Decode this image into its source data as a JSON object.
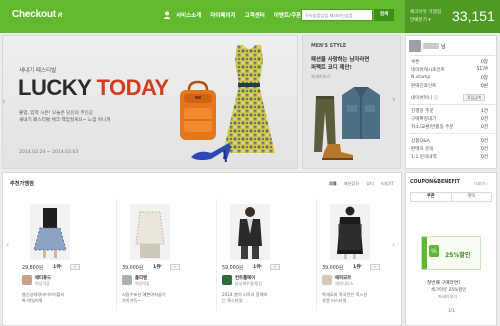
{
  "header": {
    "logo": "Checkout",
    "logo_mark": "R",
    "nav": [
      "서비스소개",
      "마이페이지",
      "고객센터",
      "이벤트/쿠폰"
    ],
    "search_placeholder": "직속상품입점 페셔라인상품",
    "search_button": "검색",
    "counter_label1": "체크아웃 가맹점",
    "counter_label2": "만배분기 ▾",
    "counter_value": "33,151",
    "accent": "#62b92e"
  },
  "hero": {
    "subtitle": "새내기 페스티벌",
    "title_a": "LUCKY",
    "title_b": "TODAY",
    "desc1": "졸업, 입학 시즌! 오늘은 당신의 주인공",
    "desc2": "새내기 페스티벌 체크 책임질게요~ 느낌 아니까",
    "date": "2014.02.24 ~ 2014.03.03"
  },
  "mens": {
    "label": "MEN'S STYLE",
    "title1": "패션을 사랑하는 남자라면",
    "title2": "퍼펙트 코디 제안!",
    "more": "자세히보기"
  },
  "panel": {
    "name_suffix": "님",
    "rows": [
      {
        "label": "쿠폰",
        "value": "0장"
      },
      {
        "label": "네이버캐시포인트",
        "value": "517P"
      },
      {
        "label": "N.stamp",
        "value": "0장"
      },
      {
        "label": "판매진포인트",
        "value": "0원"
      },
      {
        "label": "네이버머니 ⓘ",
        "value": "적립금액"
      },
      {
        "label": "진행중 주문",
        "value": "1건"
      },
      {
        "label": "구매확정대기",
        "value": "0건"
      },
      {
        "label": "취소/교환/반품중 주문",
        "value": "0건"
      },
      {
        "label": "상품Q&A",
        "value": "0건"
      },
      {
        "label": "판매자 문의",
        "value": "0건"
      },
      {
        "label": "1:1 문의내역",
        "value": "0건"
      }
    ]
  },
  "recommend": {
    "title": "추천가맹점",
    "tabs": [
      "의류",
      "패션잡화",
      "뷰티",
      "리빙/IT"
    ],
    "items": [
      {
        "price": "29,800원",
        "rank": "1위",
        "like": "+",
        "seller": "에티튜드",
        "seller_sub": "여성의류",
        "desc1": "봄신상대량바이브어플리",
        "desc2": "톡.데일리룩"
      },
      {
        "price": "39,000원",
        "rank": "1위",
        "like": "+",
        "seller": "플리텐",
        "seller_sub": "여성의류",
        "desc1": "서랍수포션 예쁜여자들이",
        "desc2": "가득가득~"
      },
      {
        "price": "59,000원",
        "rank": "1위",
        "like": "+",
        "seller": "컨트롤메이",
        "seller_sub": "남성캐주얼/정장",
        "desc1": "2014 봄이 시작과 함께하",
        "desc2": "는 룩스타일"
      },
      {
        "price": "39,000원",
        "rank": "1위",
        "like": "+",
        "seller": "에피모르",
        "seller_sub": "레이디모스",
        "desc1": "박세모와 혁국전은 럭스션",
        "desc2": "쥬얼 리스타일"
      }
    ]
  },
  "coupon": {
    "title": "COUPON&BENEFIT",
    "more": "더보기 ›",
    "tabs": [
      "쿠폰",
      "혜택"
    ],
    "percent": "25%할인",
    "t1": "첫번째 구매라면?",
    "t2": "체크아웃 25%할인",
    "t3": "자세히보기",
    "page": "1/1"
  }
}
